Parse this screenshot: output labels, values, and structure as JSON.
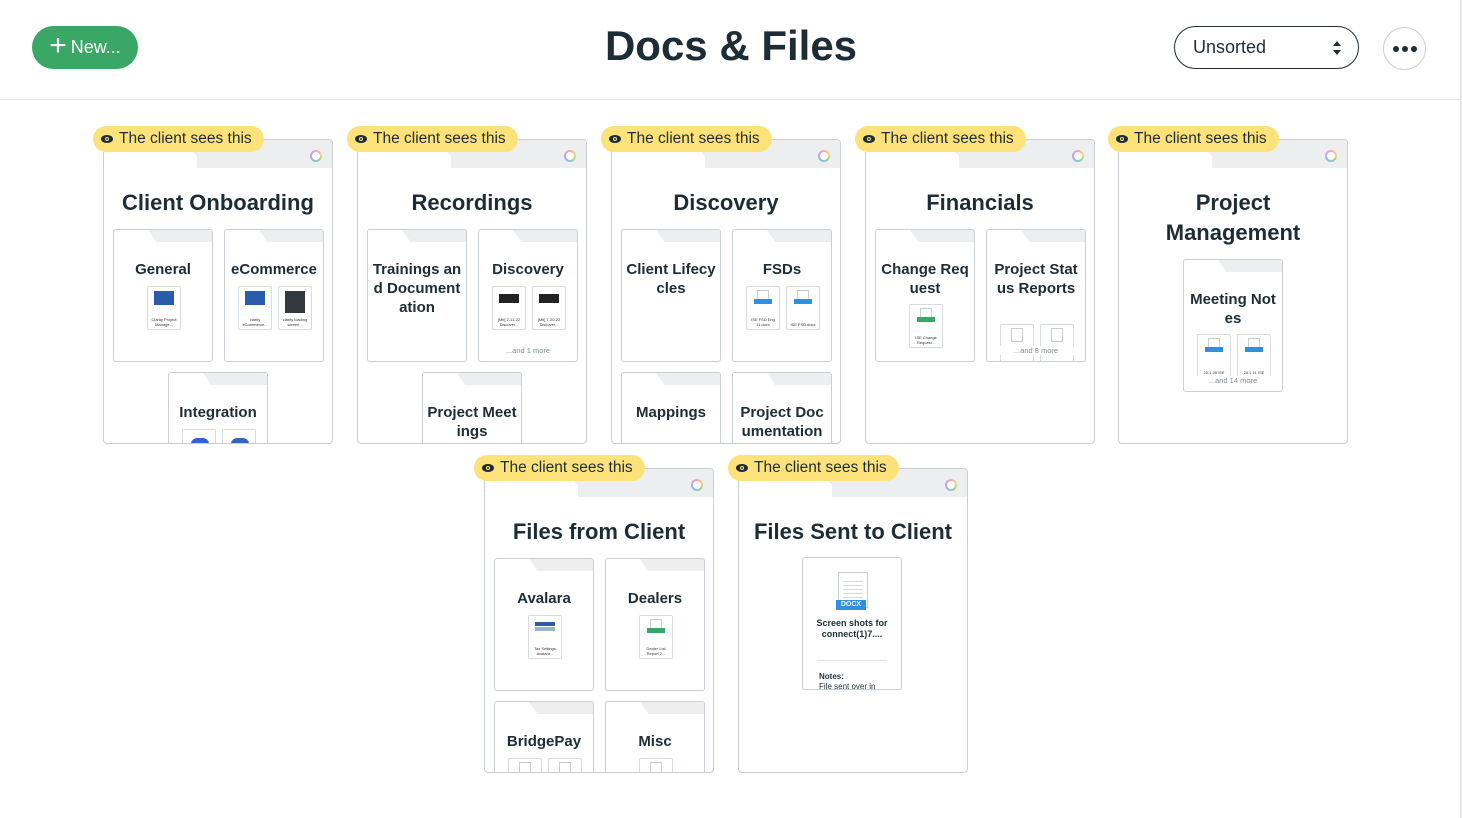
{
  "header": {
    "new_label": "New...",
    "title": "Docs & Files",
    "sort_value": "Unsorted"
  },
  "badge_text": "The client sees this",
  "folders": [
    {
      "title": "Client Onboarding",
      "subfolders": [
        {
          "label": "General",
          "thumbs": [
            {
              "kind": "blue",
              "caption": "Clarity Project Manage..."
            }
          ]
        },
        {
          "label": "eCommerce",
          "thumbs": [
            {
              "kind": "blue",
              "caption": "clarity eCommerce..."
            },
            {
              "kind": "dark",
              "caption": "clarity loading screen..."
            }
          ]
        },
        {
          "label": "Integration",
          "thumbs": [
            {
              "kind": "cloud",
              "caption": ""
            },
            {
              "kind": "cloud",
              "caption": ""
            }
          ]
        }
      ]
    },
    {
      "title": "Recordings",
      "subfolders": [
        {
          "label": "Trainings and Documentation",
          "thumbs": []
        },
        {
          "label": "Discovery",
          "thumbs": [
            {
              "kind": "video",
              "caption": "[Mtl] 7-11-22 Discover..."
            },
            {
              "kind": "video",
              "caption": "[Mtl] 7-20-22 Discover..."
            }
          ],
          "more": "...and 1 more"
        },
        {
          "label": "Project Meetings",
          "thumbs": []
        }
      ]
    },
    {
      "title": "Discovery",
      "subfolders": [
        {
          "label": "Client Lifecycles",
          "thumbs": []
        },
        {
          "label": "FSDs",
          "thumbs": [
            {
              "kind": "doc-blue",
              "caption": "ISE FSD Eng 11.docx"
            },
            {
              "kind": "doc-blue",
              "caption": "ISE FSD.docx"
            }
          ]
        },
        {
          "label": "Mappings",
          "thumbs": []
        },
        {
          "label": "Project Documentation",
          "thumbs": []
        }
      ]
    },
    {
      "title": "Financials",
      "subfolders": [
        {
          "label": "Change Request",
          "thumbs": [
            {
              "kind": "doc-green",
              "caption": "ISE Change Request..."
            }
          ]
        },
        {
          "label": "Project Status Reports",
          "thumbs": [
            {
              "kind": "doc",
              "caption": ""
            },
            {
              "kind": "doc",
              "caption": ""
            }
          ],
          "more": "...and 8 more"
        }
      ]
    },
    {
      "title": "Project Management",
      "subfolders": [
        {
          "label": "Meeting Notes",
          "thumbs": [
            {
              "kind": "doc-blue",
              "caption": "20.1.28 ISE"
            },
            {
              "kind": "doc-blue",
              "caption": "20.1.11 ISE"
            }
          ],
          "more": "...and 14 more"
        }
      ]
    },
    {
      "title": "Files from Client",
      "subfolders": [
        {
          "label": "Avalara",
          "thumbs": [
            {
              "kind": "blue-wide",
              "caption": "Tax Settings Avalara..."
            }
          ]
        },
        {
          "label": "Dealers",
          "thumbs": [
            {
              "kind": "doc-green",
              "caption": "Dealer List Report 2..."
            }
          ]
        },
        {
          "label": "BridgePay",
          "thumbs": [
            {
              "kind": "doc",
              "caption": ""
            },
            {
              "kind": "doc",
              "caption": ""
            }
          ]
        },
        {
          "label": "Misc",
          "thumbs": [
            {
              "kind": "doc",
              "caption": ""
            }
          ]
        }
      ]
    },
    {
      "title": "Files Sent to Client",
      "file": {
        "ext": "DOCX",
        "name": "Screen shots for connect(1)7....",
        "notes_label": "Notes:",
        "notes_text": "File sent over in"
      }
    }
  ],
  "colors": {
    "brand_green": "#3aa767",
    "badge_yellow": "#fde27a",
    "text_dark": "#1d2d35",
    "docx_blue": "#2f8fe0"
  },
  "icons": [
    "plus-icon",
    "sort-arrows-icon",
    "more-options-icon",
    "eye-icon",
    "sharing-ring-icon"
  ]
}
